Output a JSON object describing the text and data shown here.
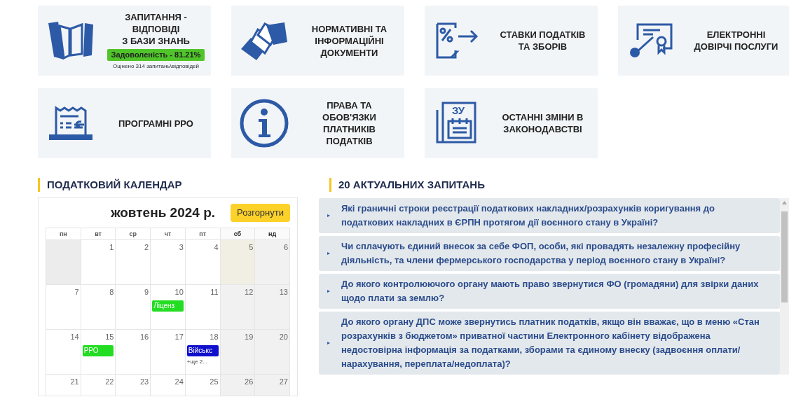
{
  "tiles": [
    {
      "kind": "book",
      "title": "ЗАПИТАННЯ -\nВІДПОВІДІ\nЗ БАЗИ ЗНАНЬ",
      "badge": "Задоволеність - 81.21%",
      "note": "Оцінено 314 запитань\\відповідей"
    },
    {
      "kind": "documents",
      "title": "НОРМАТИВНІ ТА\nІНФОРМАЦІЙНІ\nДОКУМЕНТИ"
    },
    {
      "kind": "percent",
      "title": "СТАВКИ ПОДАТКІВ\nТА ЗБОРІВ"
    },
    {
      "kind": "certificate",
      "title": "ЕЛЕКТРОННІ\nДОВІРЧІ ПОСЛУГИ"
    },
    {
      "kind": "receipt",
      "title": "ПРОГРАМНІ РРО"
    },
    {
      "kind": "info",
      "title": "ПРАВА ТА\nОБОВ'ЯЗКИ\nПЛАТНИКІВ\nПОДАТКІВ"
    },
    {
      "kind": "calendar",
      "icon_label": "ЗУ",
      "title": "ОСТАННІ ЗМІНИ В\nЗАКОНОДАВСТВІ"
    }
  ],
  "calendar": {
    "heading": "ПОДАТКОВИЙ КАЛЕНДАР",
    "month": "жовтень 2024 р.",
    "expand_button": "Розгорнути",
    "weekdays": [
      {
        "label": "пн",
        "weekend": false
      },
      {
        "label": "вт",
        "weekend": false
      },
      {
        "label": "ср",
        "weekend": false
      },
      {
        "label": "чт",
        "weekend": false
      },
      {
        "label": "пт",
        "weekend": false
      },
      {
        "label": "сб",
        "weekend": true
      },
      {
        "label": "нд",
        "weekend": true
      }
    ],
    "weeks": [
      [
        {
          "kind": "blank"
        },
        {
          "kind": "day",
          "day": "1",
          "today": false
        },
        {
          "kind": "day",
          "day": "2",
          "today": false
        },
        {
          "kind": "day",
          "day": "3",
          "today": false
        },
        {
          "kind": "day",
          "day": "4",
          "today": false
        },
        {
          "kind": "day",
          "day": "5",
          "today": true
        },
        {
          "kind": "day",
          "day": "6",
          "today": false
        }
      ],
      [
        {
          "kind": "day",
          "day": "7",
          "today": false
        },
        {
          "kind": "day",
          "day": "8",
          "today": false
        },
        {
          "kind": "day",
          "day": "9",
          "today": false
        },
        {
          "kind": "day",
          "day": "10",
          "today": false,
          "events": [
            {
              "label": "Ліценз",
              "color": "#22dd22"
            }
          ]
        },
        {
          "kind": "day",
          "day": "11",
          "today": false
        },
        {
          "kind": "day",
          "day": "12",
          "today": false
        },
        {
          "kind": "day",
          "day": "13",
          "today": false
        }
      ],
      [
        {
          "kind": "day",
          "day": "14",
          "today": false
        },
        {
          "kind": "day",
          "day": "15",
          "today": false,
          "events": [
            {
              "label": "РРО",
              "color": "#22dd22"
            }
          ]
        },
        {
          "kind": "day",
          "day": "16",
          "today": false
        },
        {
          "kind": "day",
          "day": "17",
          "today": false
        },
        {
          "kind": "day",
          "day": "18",
          "today": false,
          "events": [
            {
              "label": "Військс",
              "color": "#1010cc"
            }
          ],
          "more": "+ще 2..."
        },
        {
          "kind": "day",
          "day": "19",
          "today": false
        },
        {
          "kind": "day",
          "day": "20",
          "today": false
        }
      ],
      [
        {
          "kind": "day",
          "day": "21",
          "today": false
        },
        {
          "kind": "day",
          "day": "22",
          "today": false
        },
        {
          "kind": "day",
          "day": "23",
          "today": false
        },
        {
          "kind": "day",
          "day": "24",
          "today": false
        },
        {
          "kind": "day",
          "day": "25",
          "today": false
        },
        {
          "kind": "day",
          "day": "26",
          "today": false
        },
        {
          "kind": "day",
          "day": "27",
          "today": false
        }
      ]
    ]
  },
  "questions": {
    "heading": "20 АКТУАЛЬНИХ ЗАПИТАНЬ",
    "items": [
      {
        "marker": "▸",
        "text": "Які граничні строки реєстрації податкових накладних/розрахунків коригування до податкових накладних в ЄРПН протягом дії воєнного стану в Україні?"
      },
      {
        "marker": "▸",
        "text": "Чи сплачують єдиний внесок за себе ФОП, особи, які провадять незалежну професійну діяльність, та члени фермерського господарства у період воєнного стану в Україні?"
      },
      {
        "marker": "▸",
        "text": "До якого контролюючого органу мають право звернутися ФО (громадяни) для звірки даних щодо плати за землю?"
      },
      {
        "marker": "▸",
        "text": "До якого органу ДПС може звернутись платник податків, якщо він вважає, що в меню «Стан розрахунків з бюджетом» приватної частини Електронного кабінету відображена недостовірна інформація за податками, зборами та єдиному внеску (задвоєння оплати/нарахування, переплата/недоплата)?"
      }
    ]
  }
}
